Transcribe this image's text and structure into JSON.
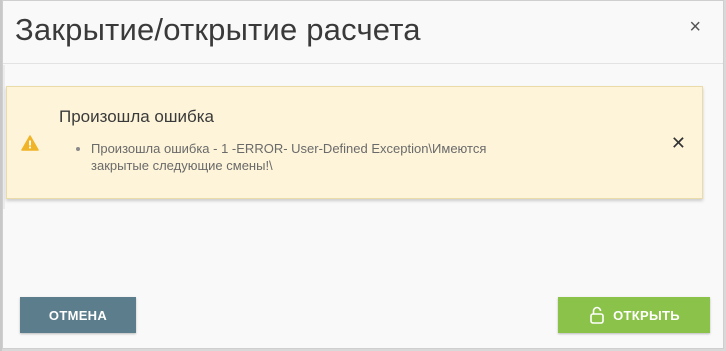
{
  "dialog": {
    "title": "Закрытие/открытие расчета",
    "close_glyph": "×"
  },
  "alert": {
    "title": "Произошла ошибка",
    "messages": [
      "Произошла ошибка - 1 -ERROR- User-Defined Exception\\Имеются закрытые следующие смены!\\"
    ],
    "close_glyph": "✕",
    "icon": "warning-triangle-icon",
    "background_color": "#fdf4d9",
    "icon_color": "#f0b429"
  },
  "buttons": {
    "cancel_label": "ОТМЕНА",
    "open_label": "ОТКРЫТЬ",
    "cancel_color": "#5c7d8b",
    "open_color": "#8bc34a",
    "open_icon": "unlock-icon"
  }
}
